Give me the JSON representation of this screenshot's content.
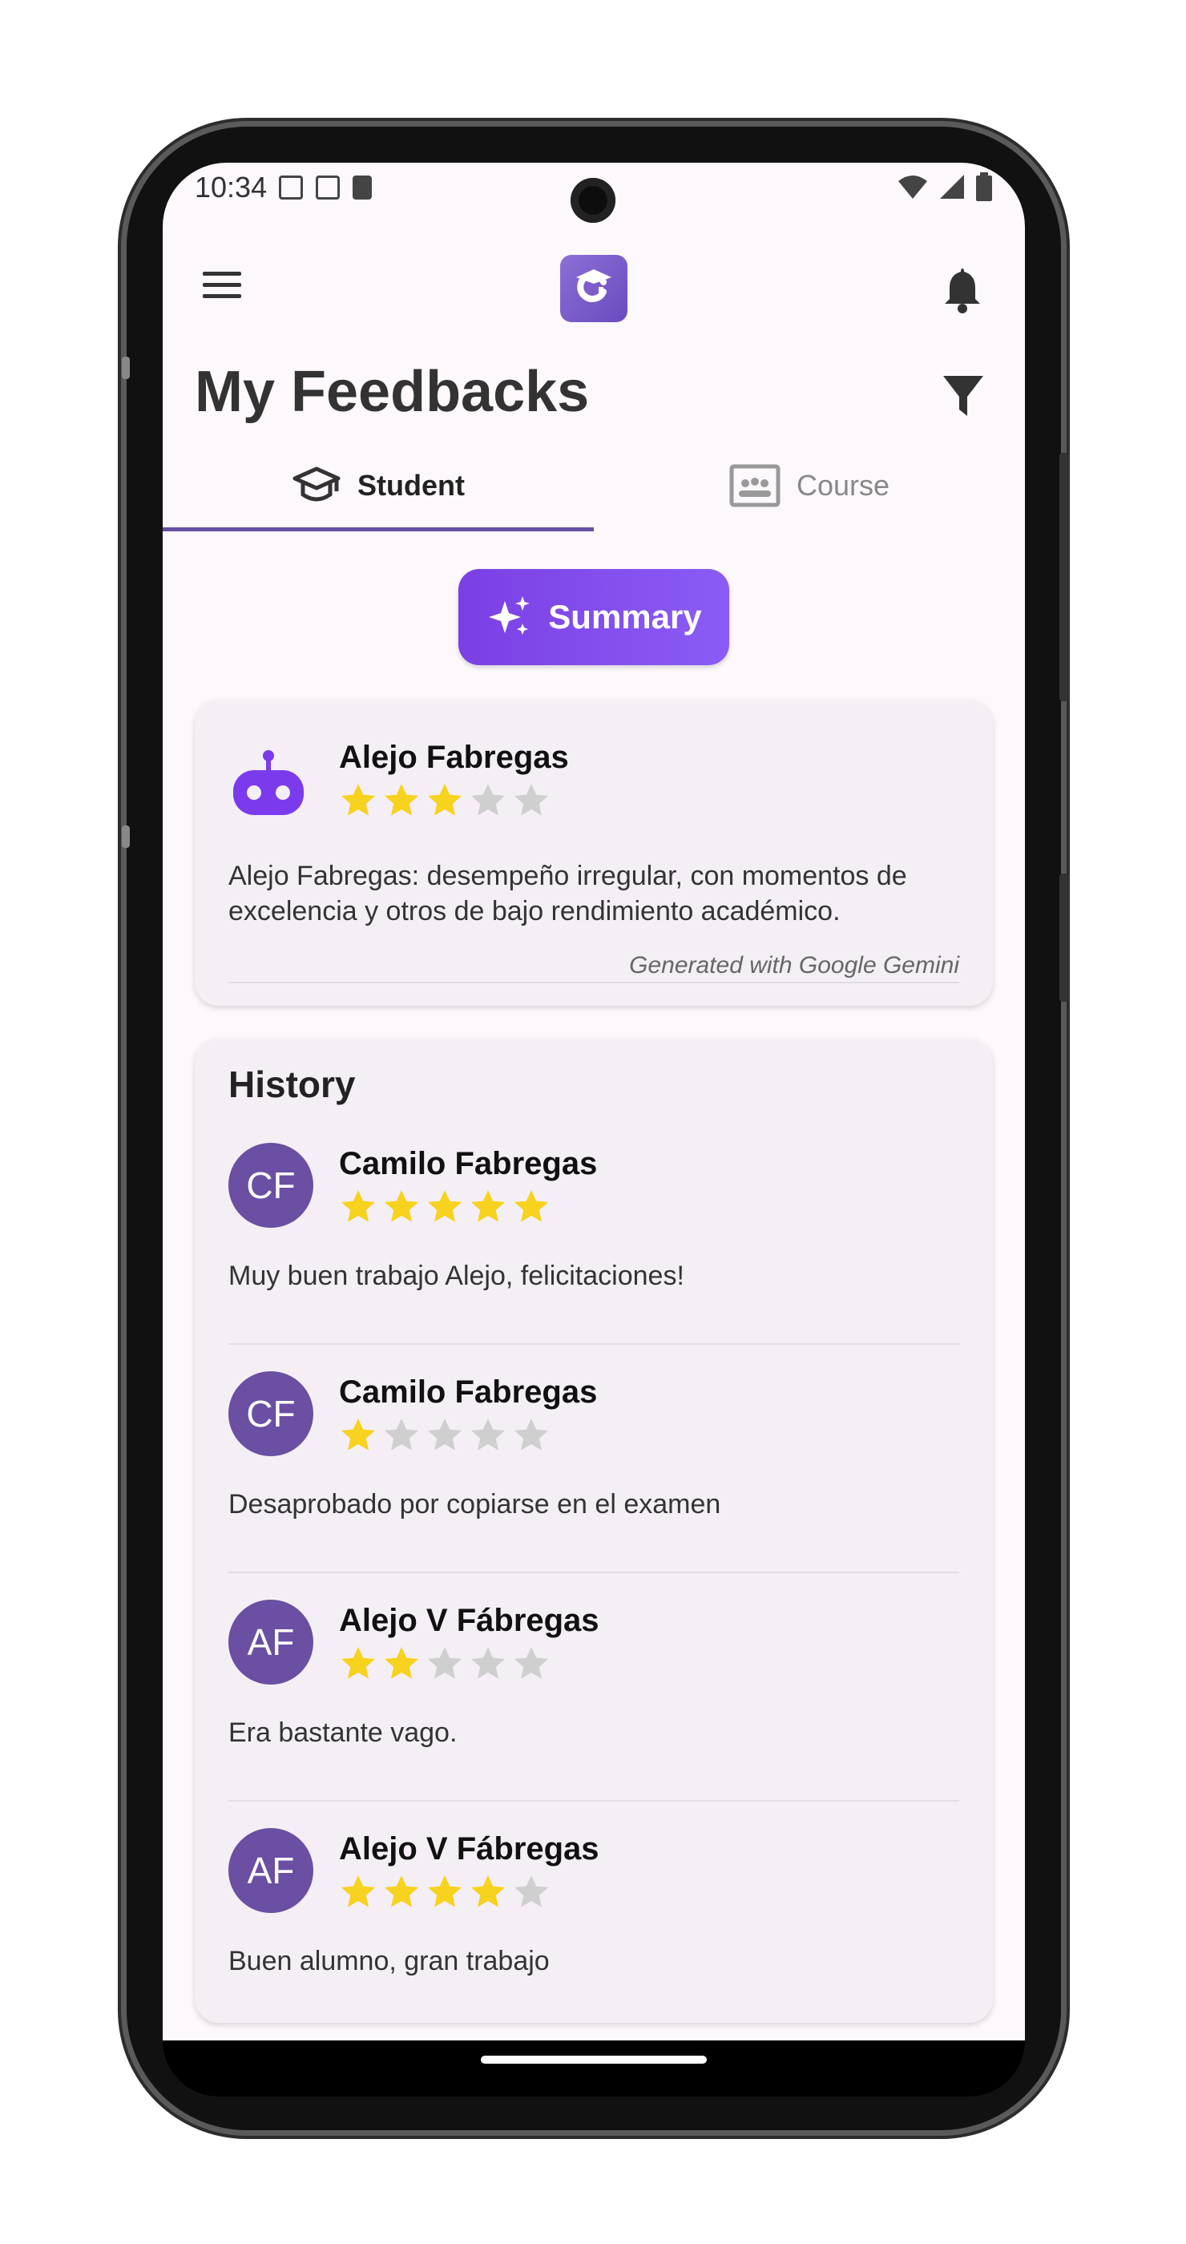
{
  "status_bar": {
    "time": "10:34"
  },
  "app_bar": {
    "title": "My Feedbacks"
  },
  "tabs": [
    {
      "label": "Student",
      "icon": "graduation-cap-icon",
      "active": true
    },
    {
      "label": "Course",
      "icon": "classroom-icon",
      "active": false
    }
  ],
  "summary_button": {
    "label": "Summary",
    "icon": "sparkles-icon"
  },
  "summary_card": {
    "name": "Alejo Fabregas",
    "rating": 3,
    "text": "Alejo Fabregas: desempeño irregular, con momentos de excelencia y otros de bajo rendimiento académico.",
    "footer": "Generated with Google Gemini",
    "icon": "robot-icon"
  },
  "history": {
    "title": "History",
    "items": [
      {
        "initials": "CF",
        "name": "Camilo Fabregas",
        "rating": 5,
        "comment": "Muy buen trabajo Alejo, felicitaciones!"
      },
      {
        "initials": "CF",
        "name": "Camilo Fabregas",
        "rating": 1,
        "comment": "Desaprobado por copiarse en el examen"
      },
      {
        "initials": "AF",
        "name": "Alejo V Fábregas",
        "rating": 2,
        "comment": "Era bastante vago."
      },
      {
        "initials": "AF",
        "name": "Alejo V Fábregas",
        "rating": 4,
        "comment": "Buen alumno, gran trabajo"
      }
    ]
  },
  "colors": {
    "primary": "#6750a4",
    "accent": "#7b3fe4",
    "star_filled": "#f7d21e",
    "star_empty": "#cfcfcf",
    "avatar": "#6a4fa3"
  }
}
